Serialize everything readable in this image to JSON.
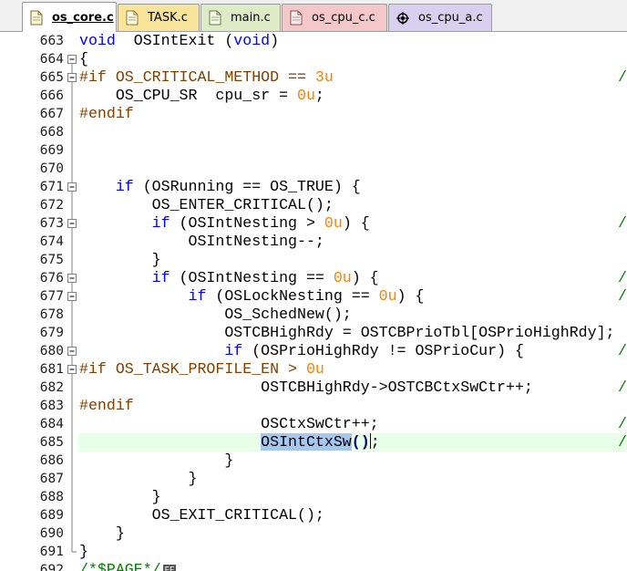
{
  "tabs": [
    {
      "label": "os_core.c",
      "active": true
    },
    {
      "label": "TASK.c",
      "active": false
    },
    {
      "label": "main.c",
      "active": false
    },
    {
      "label": "os_cpu_c.c",
      "active": false
    },
    {
      "label": "os_cpu_a.c",
      "active": false
    }
  ],
  "colors": {
    "keyword": "#0000ff",
    "preprocessor": "#804000",
    "number": "#ff8000",
    "comment": "#008000",
    "current_line": "#e8ffe8",
    "selection": "#a6c8f0"
  },
  "editor": {
    "lines": [
      {
        "num": "663"
      },
      {
        "num": "664"
      },
      {
        "num": "665"
      },
      {
        "num": "666"
      },
      {
        "num": "667"
      },
      {
        "num": "668"
      },
      {
        "num": "669"
      },
      {
        "num": "670"
      },
      {
        "num": "671"
      },
      {
        "num": "672"
      },
      {
        "num": "673"
      },
      {
        "num": "674"
      },
      {
        "num": "675"
      },
      {
        "num": "676"
      },
      {
        "num": "677"
      },
      {
        "num": "678"
      },
      {
        "num": "679"
      },
      {
        "num": "680"
      },
      {
        "num": "681"
      },
      {
        "num": "682"
      },
      {
        "num": "683"
      },
      {
        "num": "684"
      },
      {
        "num": "685"
      },
      {
        "num": "686"
      },
      {
        "num": "687"
      },
      {
        "num": "688"
      },
      {
        "num": "689"
      },
      {
        "num": "690"
      },
      {
        "num": "691"
      },
      {
        "num": "692"
      }
    ],
    "code": {
      "l663": {
        "kw1": "void",
        "name": "  OSIntExit (",
        "kw2": "void",
        "end": ")"
      },
      "l664": {
        "text": "{"
      },
      "l665": {
        "pp": "#if",
        "mid": " OS_CRITICAL_METHOD == ",
        "num": "3u"
      },
      "l666": {
        "text": "    OS_CPU_SR  cpu_sr = ",
        "num": "0u",
        "end": ";"
      },
      "l667": {
        "pp": "#endif"
      },
      "l671": {
        "pre": "    ",
        "kw": "if",
        "rest": " (OSRunning == OS_TRUE) {"
      },
      "l672": {
        "text": "        OS_ENTER_CRITICAL();"
      },
      "l673": {
        "pre": "        ",
        "kw": "if",
        "mid": " (OSIntNesting > ",
        "num": "0u",
        "rest": ") {"
      },
      "l674": {
        "text": "            OSIntNesting--;"
      },
      "l675": {
        "text": "        }"
      },
      "l676": {
        "pre": "        ",
        "kw": "if",
        "mid": " (OSIntNesting == ",
        "num": "0u",
        "rest": ") {"
      },
      "l677": {
        "pre": "            ",
        "kw": "if",
        "mid": " (OSLockNesting == ",
        "num": "0u",
        "rest": ") {"
      },
      "l678": {
        "text": "                OS_SchedNew();"
      },
      "l679": {
        "text": "                OSTCBHighRdy = OSTCBPrioTbl[OSPrioHighRdy];"
      },
      "l680": {
        "pre": "                ",
        "kw": "if",
        "rest": " (OSPrioHighRdy != OSPrioCur) {"
      },
      "l681": {
        "pp": "#if",
        "mid": " OS_TASK_PROFILE_EN > ",
        "num": "0u"
      },
      "l682": {
        "text": "                    OSTCBHighRdy->OSTCBCtxSwCtr++;"
      },
      "l683": {
        "pp": "#endif"
      },
      "l684": {
        "text": "                    OSCtxSwCtr++;"
      },
      "l685": {
        "pre": "                    ",
        "sel": "OSIntCtxSw",
        "br": "()",
        "end": ";"
      },
      "l686": {
        "text": "                }"
      },
      "l687": {
        "text": "            }"
      },
      "l688": {
        "text": "        }"
      },
      "l689": {
        "text": "        OS_EXIT_CRITICAL();"
      },
      "l690": {
        "text": "    }"
      },
      "l691": {
        "text": "}"
      },
      "l692": {
        "cm": "/*$PAGE*/"
      }
    },
    "comment_tail": "/"
  }
}
